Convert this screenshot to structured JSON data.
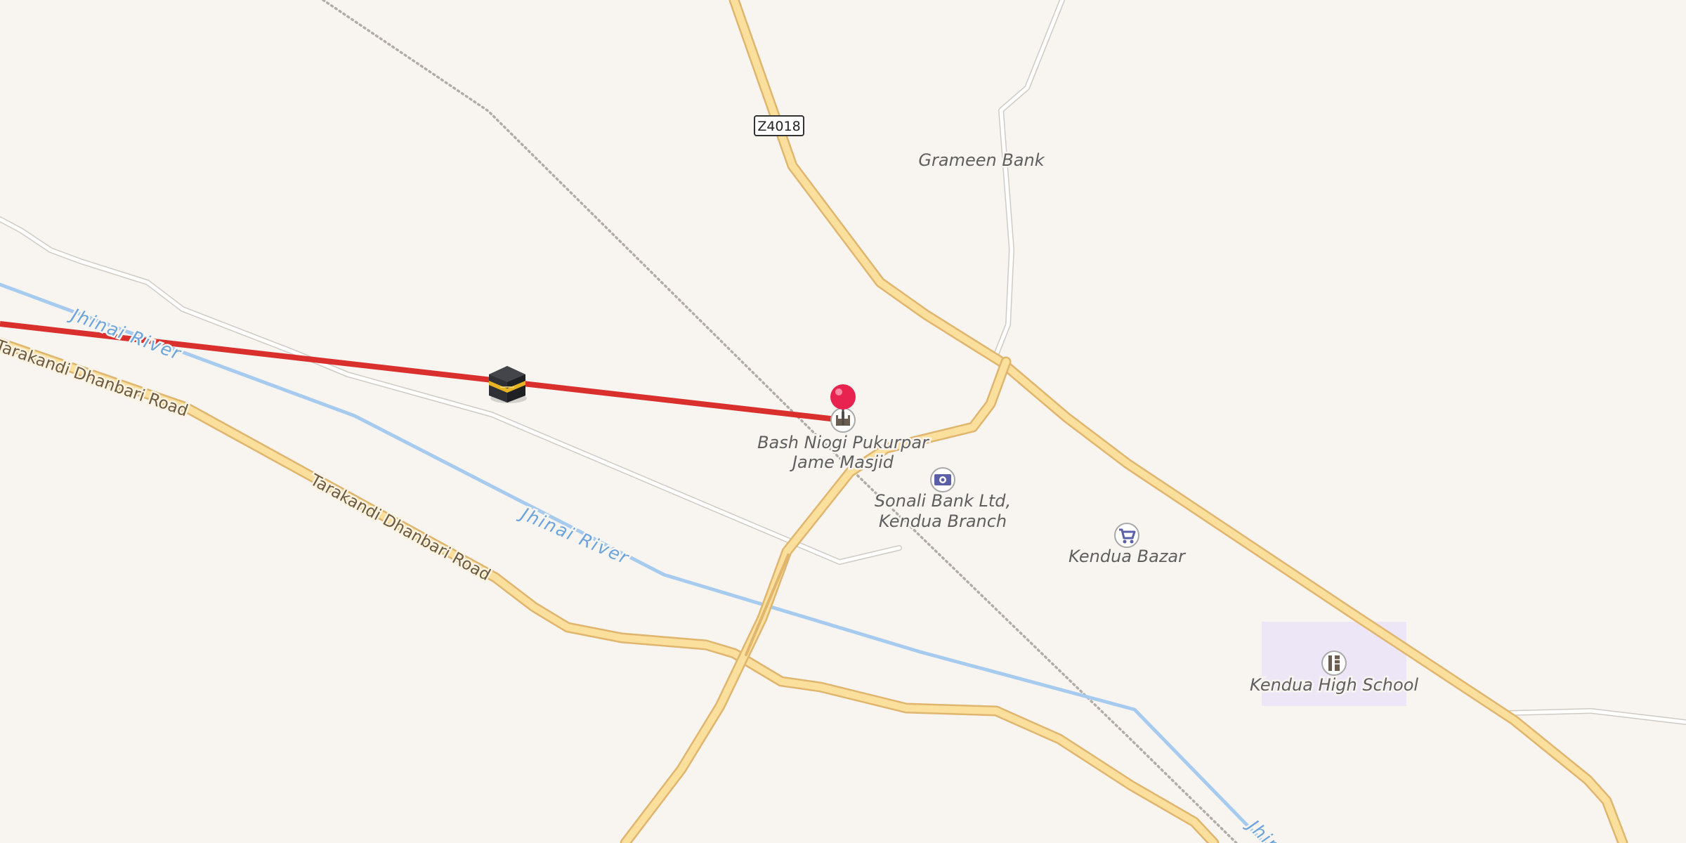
{
  "map": {
    "roads": {
      "tarakandi_dhanbari_1": "Tarakandi Dhanbari Road",
      "tarakandi_dhanbari_2": "Tarakandi Dhanbari Road",
      "route_shield": "Z4018"
    },
    "rivers": {
      "jhinai_1": "Jhinai River",
      "jhinai_2": "Jhinai River",
      "jhinai_3": "Jhin"
    },
    "pois": {
      "grameen_bank": "Grameen Bank",
      "mosque_line1": "Bash Niogi Pukurpar",
      "mosque_line2": "Jame Masjid",
      "sonali_line1": "Sonali Bank Ltd,",
      "sonali_line2": "Kendua Branch",
      "kendua_bazar": "Kendua Bazar",
      "kendua_high_school": "Kendua High School"
    },
    "icons": {
      "selected_marker": "red-pin-icon",
      "mosque": "mosque-icon",
      "bank": "bank-icon",
      "market": "shopping-cart-icon",
      "school": "school-icon",
      "qibla": "kaaba-icon"
    },
    "colors": {
      "background": "#f8f5f1",
      "major_road": "#fbdf9c",
      "river": "#a6cbef",
      "qibla_line": "#d9302e",
      "pin": "#e8234f",
      "school_area": "#ede6f6",
      "poi_icon": "#5b5fa8"
    }
  }
}
